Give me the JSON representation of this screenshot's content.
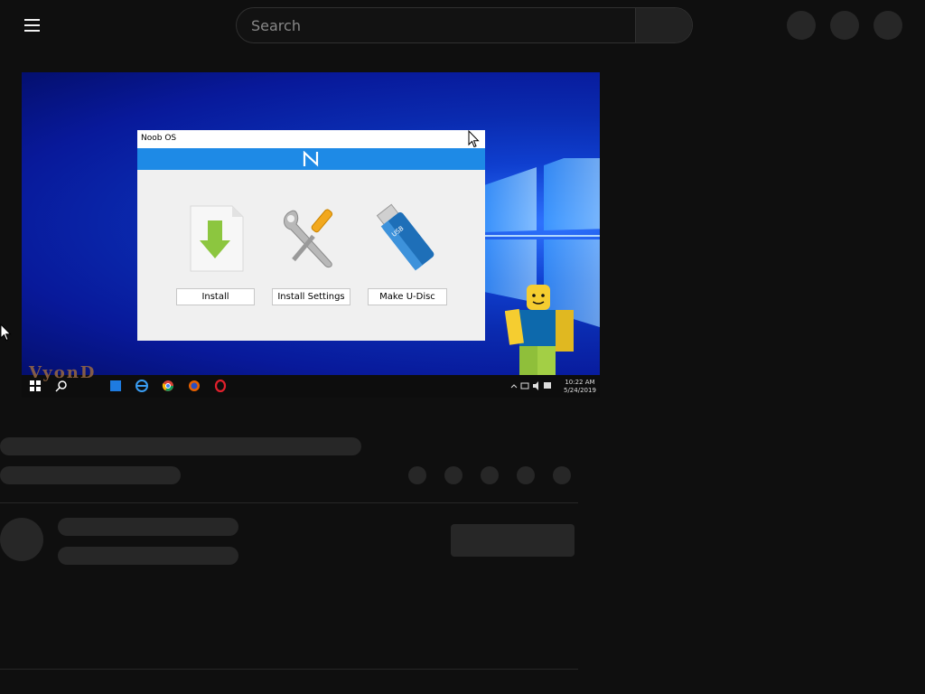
{
  "search": {
    "placeholder": "Search"
  },
  "video": {
    "app_window": {
      "title": "Noob OS",
      "buttons": [
        "Install",
        "Install Settings",
        "Make U-Disc"
      ],
      "usb_label": "USB"
    },
    "watermark": "VyonD",
    "taskbar": {
      "time": "10:22 AM",
      "date": "5/24/2019"
    }
  },
  "colors": {
    "page_bg": "#0f0f0f",
    "skeleton": "#272727",
    "banner_blue": "#1e8ae6",
    "desktop_blue": "#0a2bb0"
  }
}
